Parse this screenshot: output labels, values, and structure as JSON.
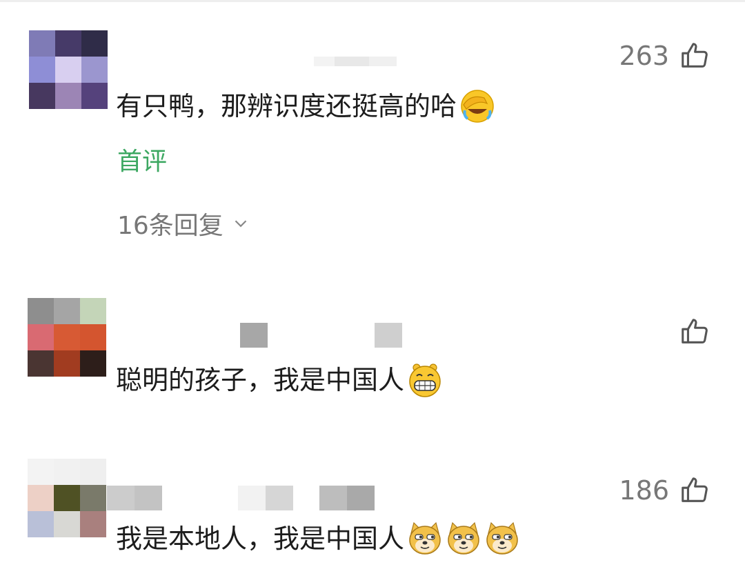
{
  "comments": [
    {
      "text": "有只鸭，那辨识度还挺高的哈",
      "emoji": "facepalm-laugh-emoji",
      "likes": "263",
      "badge": "首评",
      "replies_label": "16条回复"
    },
    {
      "text": "聪明的孩子，我是中国人",
      "emoji": "grin-emoji",
      "likes": ""
    },
    {
      "text": "我是本地人，我是中国人",
      "emoji": "doge-emoji",
      "emoji_count": 3,
      "likes": "186"
    }
  ],
  "icons": {
    "like": "thumbs-up-icon",
    "expand": "chevron-down-icon"
  },
  "colors": {
    "badge": "#3da862",
    "meta": "#777777",
    "text": "#1c1c1c"
  }
}
